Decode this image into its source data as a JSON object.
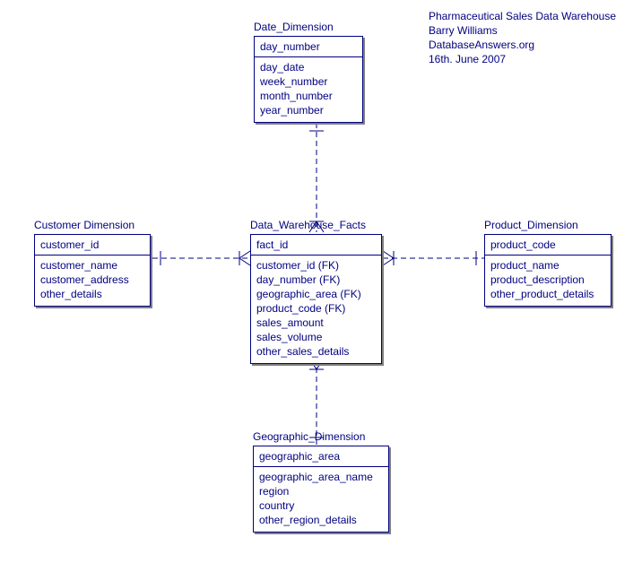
{
  "meta": {
    "title": "Pharmaceutical Sales Data Warehouse",
    "author": "Barry Williams",
    "site": "DatabaseAnswers.org",
    "date": "16th. June 2007"
  },
  "entities": {
    "date": {
      "title": "Date_Dimension",
      "pk": "day_number",
      "attrs": [
        "day_date",
        "week_number",
        "month_number",
        "year_number"
      ]
    },
    "customer": {
      "title": "Customer Dimension",
      "pk": "customer_id",
      "attrs": [
        "customer_name",
        "customer_address",
        "other_details"
      ]
    },
    "facts": {
      "title": "Data_Warehouse_Facts",
      "pk": "fact_id",
      "attrs": [
        "customer_id (FK)",
        "day_number (FK)",
        "geographic_area (FK)",
        "product_code (FK)",
        "sales_amount",
        "sales_volume",
        "other_sales_details"
      ]
    },
    "product": {
      "title": "Product_Dimension",
      "pk": "product_code",
      "attrs": [
        "product_name",
        "product_description",
        "other_product_details"
      ]
    },
    "geographic": {
      "title": "Geographic_Dimension",
      "pk": "geographic_area",
      "attrs": [
        "geographic_area_name",
        "region",
        "country",
        "other_region_details"
      ]
    }
  }
}
